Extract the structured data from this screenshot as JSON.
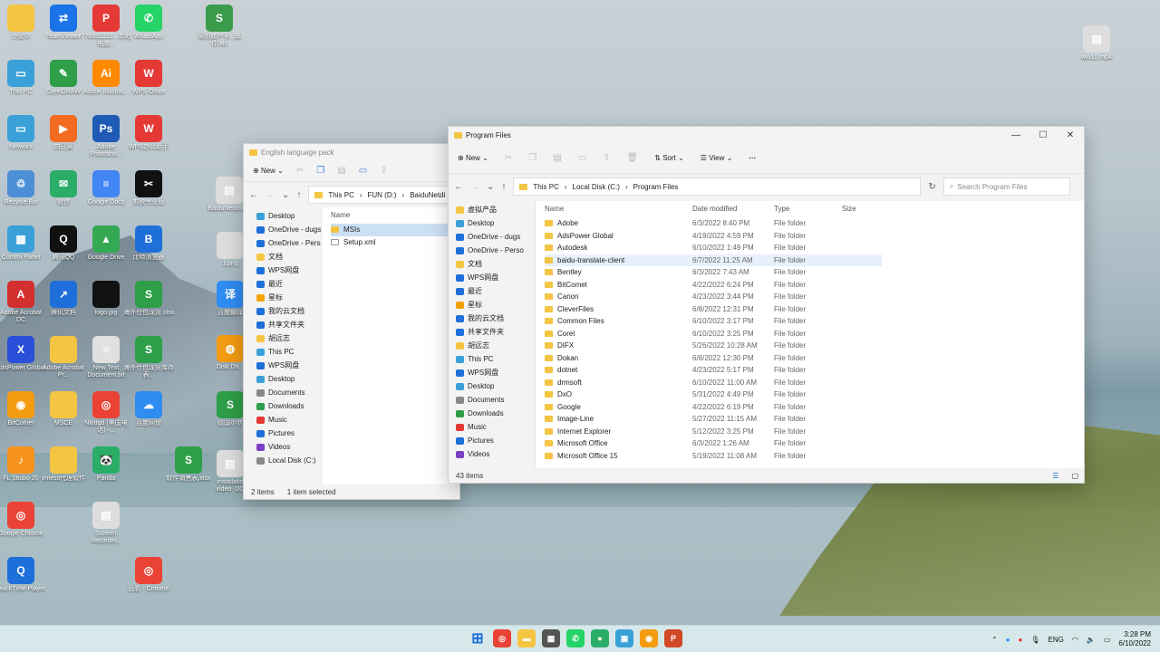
{
  "desktop": {
    "icons": [
      {
        "label": "沙盘中",
        "color": "#f4c542",
        "glyph": ""
      },
      {
        "label": "TeamViewer",
        "color": "#1a73e8",
        "glyph": "⇄"
      },
      {
        "label": "778592222...本地电脑...",
        "color": "#e53935",
        "glyph": "P"
      },
      {
        "label": "WhatsApp",
        "color": "#25d366",
        "glyph": "✆"
      },
      {
        "label": "深圳商户卡...邮件.xls",
        "color": "#3a9b4b",
        "glyph": "S"
      },
      {
        "label": "This PC",
        "color": "#3aa0d8",
        "glyph": "▭"
      },
      {
        "label": "CorelDRAW",
        "color": "#2e9e48",
        "glyph": "✎"
      },
      {
        "label": "Adobe Illustrat...",
        "color": "#ff8a00",
        "glyph": "Ai"
      },
      {
        "label": "WPS Office",
        "color": "#e53935",
        "glyph": "W"
      },
      {
        "label": "Network",
        "color": "#3aa0d8",
        "glyph": "▭"
      },
      {
        "label": "向日葵",
        "color": "#f26b21",
        "glyph": "▶"
      },
      {
        "label": "Adobe Photosho...",
        "color": "#1f5bb5",
        "glyph": "Ps"
      },
      {
        "label": "WPS办公助手",
        "color": "#e53935",
        "glyph": "W"
      },
      {
        "label": "Recycle Bin",
        "color": "#4c8fd6",
        "glyph": "♲"
      },
      {
        "label": "微信",
        "color": "#2aae67",
        "glyph": "✉"
      },
      {
        "label": "Google Docs",
        "color": "#4285f4",
        "glyph": "≡"
      },
      {
        "label": "剪映专业版",
        "color": "#111111",
        "glyph": "✂"
      },
      {
        "label": "Control Panel",
        "color": "#3aa0d8",
        "glyph": "▦"
      },
      {
        "label": "腾讯QQ",
        "color": "#111111",
        "glyph": "Q"
      },
      {
        "label": "Google Drive",
        "color": "#34a853",
        "glyph": "▲"
      },
      {
        "label": "比特浏览器",
        "color": "#1e6fd9",
        "glyph": "B"
      },
      {
        "label": "Adobe Acrobat DC",
        "color": "#d32f2f",
        "glyph": "A"
      },
      {
        "label": "腾讯文档",
        "color": "#1e6fd9",
        "glyph": "↗"
      },
      {
        "label": "logo.jpg",
        "color": "#111111",
        "glyph": ""
      },
      {
        "label": "海外仓包现货.xlsx",
        "color": "#2e9e48",
        "glyph": "S"
      },
      {
        "label": "AdsPower Global",
        "color": "#2a4fd8",
        "glyph": "X"
      },
      {
        "label": "Adobe Acrobat Pr...",
        "color": "#f4c542",
        "glyph": ""
      },
      {
        "label": "New Text Document.txt",
        "color": "#e0e0e0",
        "glyph": "≡"
      },
      {
        "label": "海外仓包现货库存表...",
        "color": "#2e9e48",
        "glyph": "S"
      },
      {
        "label": "BitComet",
        "color": "#f39c12",
        "glyph": "◉"
      },
      {
        "label": "MSCE",
        "color": "#f4c542",
        "glyph": ""
      },
      {
        "label": "Nkfdgd (美国电话) -...",
        "color": "#ea4335",
        "glyph": "◎"
      },
      {
        "label": "百度网盘",
        "color": "#2f8cf0",
        "glyph": "☁"
      },
      {
        "label": "FL Studio 20",
        "color": "#f7931e",
        "glyph": "♪"
      },
      {
        "label": "vmess代理软件",
        "color": "#f4c542",
        "glyph": ""
      },
      {
        "label": "Panda",
        "color": "#2aae67",
        "glyph": "🐼"
      },
      {
        "label": "软件销售表.xlsx",
        "color": "#2e9e48",
        "glyph": "S"
      },
      {
        "label": "Google Chrome",
        "color": "#ea4335",
        "glyph": "◎"
      },
      {
        "label": "Screen Recordin...",
        "color": "#dddddd",
        "glyph": "▤"
      },
      {
        "label": "QuickTime Player",
        "color": "#1e6fd9",
        "glyph": "Q"
      },
      {
        "label": "远名 - Chrome",
        "color": "#ea4335",
        "glyph": "◎"
      },
      {
        "label": "win10.mp4",
        "color": "#dddddd",
        "glyph": "▤"
      },
      {
        "label": "BaiduNetdisk...",
        "color": "#dddddd",
        "glyph": "▤"
      },
      {
        "label": "1.png",
        "color": "#dddddd",
        "glyph": ""
      },
      {
        "label": "百度翻译",
        "color": "#2f8cf0",
        "glyph": "译"
      },
      {
        "label": "Disk Dri...",
        "color": "#f39c12",
        "glyph": "◍"
      },
      {
        "label": "德国小票",
        "color": "#2e9e48",
        "glyph": "S"
      },
      {
        "label": "installatio video_DC",
        "color": "#dddddd",
        "glyph": "▤"
      }
    ]
  },
  "back_window": {
    "title": "English language pack",
    "new_label": "New",
    "breadcrumb": [
      "This PC",
      "FUN (D:)",
      "BaiduNetdi"
    ],
    "nav": [
      {
        "label": "Desktop",
        "color": "#3aa0d8"
      },
      {
        "label": "OneDrive - dugs",
        "color": "#1e6fd9"
      },
      {
        "label": "OneDrive - Perso",
        "color": "#1e6fd9"
      },
      {
        "label": "文档",
        "color": "#f4c542"
      },
      {
        "label": "WPS网盘",
        "color": "#1e6fd9"
      },
      {
        "label": "最近",
        "color": "#1e6fd9"
      },
      {
        "label": "星标",
        "color": "#f4a100"
      },
      {
        "label": "我的云文档",
        "color": "#1e6fd9"
      },
      {
        "label": "共享文件夹",
        "color": "#1e6fd9"
      },
      {
        "label": "胡远志",
        "color": "#f4c542"
      },
      {
        "label": "This PC",
        "color": "#3aa0d8"
      },
      {
        "label": "WPS网盘",
        "color": "#1e6fd9"
      },
      {
        "label": "Desktop",
        "color": "#3aa0d8"
      },
      {
        "label": "Documents",
        "color": "#888888"
      },
      {
        "label": "Downloads",
        "color": "#2e9e48"
      },
      {
        "label": "Music",
        "color": "#e53935"
      },
      {
        "label": "Pictures",
        "color": "#1e6fd9"
      },
      {
        "label": "Videos",
        "color": "#7b3fc4"
      },
      {
        "label": "Local Disk (C:)",
        "color": "#888888"
      }
    ],
    "col_name": "Name",
    "files": [
      {
        "name": "MSIs",
        "selected": true,
        "folder": true
      },
      {
        "name": "Setup.xml",
        "selected": false,
        "folder": false
      }
    ],
    "status_items": "2 items",
    "status_selected": "1 item selected"
  },
  "front_window": {
    "title": "Program Files",
    "new_label": "New",
    "sort_label": "Sort",
    "view_label": "View",
    "more_label": "···",
    "breadcrumb": [
      "This PC",
      "Local Disk (C:)",
      "Program Files"
    ],
    "search_placeholder": "Search Program Files",
    "nav": [
      {
        "label": "虚拟产品",
        "color": "#f4c542"
      },
      {
        "label": "Desktop",
        "color": "#3aa0d8"
      },
      {
        "label": "OneDrive - dugs",
        "color": "#1e6fd9"
      },
      {
        "label": "OneDrive - Perso",
        "color": "#1e6fd9"
      },
      {
        "label": "文档",
        "color": "#f4c542"
      },
      {
        "label": "WPS网盘",
        "color": "#1e6fd9"
      },
      {
        "label": "最近",
        "color": "#1e6fd9"
      },
      {
        "label": "星标",
        "color": "#f4a100"
      },
      {
        "label": "我的云文档",
        "color": "#1e6fd9"
      },
      {
        "label": "共享文件夹",
        "color": "#1e6fd9"
      },
      {
        "label": "胡远志",
        "color": "#f4c542"
      },
      {
        "label": "This PC",
        "color": "#3aa0d8"
      },
      {
        "label": "WPS网盘",
        "color": "#1e6fd9"
      },
      {
        "label": "Desktop",
        "color": "#3aa0d8"
      },
      {
        "label": "Documents",
        "color": "#888888"
      },
      {
        "label": "Downloads",
        "color": "#2e9e48"
      },
      {
        "label": "Music",
        "color": "#e53935"
      },
      {
        "label": "Pictures",
        "color": "#1e6fd9"
      },
      {
        "label": "Videos",
        "color": "#7b3fc4"
      }
    ],
    "columns": {
      "name": "Name",
      "date": "Date modified",
      "type": "Type",
      "size": "Size"
    },
    "files": [
      {
        "name": "Adobe",
        "date": "6/3/2022 8:40 PM",
        "type": "File folder",
        "hover": false
      },
      {
        "name": "AdsPower Global",
        "date": "4/19/2022 4:59 PM",
        "type": "File folder",
        "hover": false
      },
      {
        "name": "Autodesk",
        "date": "6/10/2022 1:49 PM",
        "type": "File folder",
        "hover": false
      },
      {
        "name": "baidu-translate-client",
        "date": "6/7/2022 11:25 AM",
        "type": "File folder",
        "hover": true
      },
      {
        "name": "Bentley",
        "date": "6/3/2022 7:43 AM",
        "type": "File folder",
        "hover": false
      },
      {
        "name": "BitComet",
        "date": "4/22/2022 6:24 PM",
        "type": "File folder",
        "hover": false
      },
      {
        "name": "Canon",
        "date": "4/23/2022 3:44 PM",
        "type": "File folder",
        "hover": false
      },
      {
        "name": "CleverFiles",
        "date": "6/8/2022 12:31 PM",
        "type": "File folder",
        "hover": false
      },
      {
        "name": "Common Files",
        "date": "6/10/2022 3:17 PM",
        "type": "File folder",
        "hover": false
      },
      {
        "name": "Corel",
        "date": "6/10/2022 3:25 PM",
        "type": "File folder",
        "hover": false
      },
      {
        "name": "DIFX",
        "date": "5/26/2022 10:28 AM",
        "type": "File folder",
        "hover": false
      },
      {
        "name": "Dokan",
        "date": "6/8/2022 12:30 PM",
        "type": "File folder",
        "hover": false
      },
      {
        "name": "dotnet",
        "date": "4/23/2022 5:17 PM",
        "type": "File folder",
        "hover": false
      },
      {
        "name": "drmsoft",
        "date": "6/10/2022 11:00 AM",
        "type": "File folder",
        "hover": false
      },
      {
        "name": "DxO",
        "date": "5/31/2022 4:49 PM",
        "type": "File folder",
        "hover": false
      },
      {
        "name": "Google",
        "date": "4/22/2022 6:19 PM",
        "type": "File folder",
        "hover": false
      },
      {
        "name": "Image-Line",
        "date": "5/27/2022 11:15 AM",
        "type": "File folder",
        "hover": false
      },
      {
        "name": "Internet Explorer",
        "date": "5/12/2022 3:25 PM",
        "type": "File folder",
        "hover": false
      },
      {
        "name": "Microsoft Office",
        "date": "6/3/2022 1:26 AM",
        "type": "File folder",
        "hover": false
      },
      {
        "name": "Microsoft Office 15",
        "date": "5/19/2022 11:08 AM",
        "type": "File folder",
        "hover": false
      }
    ],
    "status_items": "43 items"
  },
  "taskbar": {
    "apps": [
      {
        "name": "start",
        "color": "#1e6fd9",
        "glyph": "⊞"
      },
      {
        "name": "chrome",
        "color": "#ea4335",
        "glyph": "◎"
      },
      {
        "name": "file-explorer",
        "color": "#f4c542",
        "glyph": "▬"
      },
      {
        "name": "calculator",
        "color": "#555555",
        "glyph": "▦"
      },
      {
        "name": "whatsapp",
        "color": "#25d366",
        "glyph": "✆"
      },
      {
        "name": "panda",
        "color": "#2aae67",
        "glyph": "●"
      },
      {
        "name": "photos",
        "color": "#3aa0d8",
        "glyph": "▣"
      },
      {
        "name": "bitcomet",
        "color": "#f39c12",
        "glyph": "◉"
      },
      {
        "name": "powerpoint",
        "color": "#d24726",
        "glyph": "P"
      }
    ],
    "lang": "ENG",
    "time": "3:28 PM",
    "date": "6/10/2022"
  }
}
